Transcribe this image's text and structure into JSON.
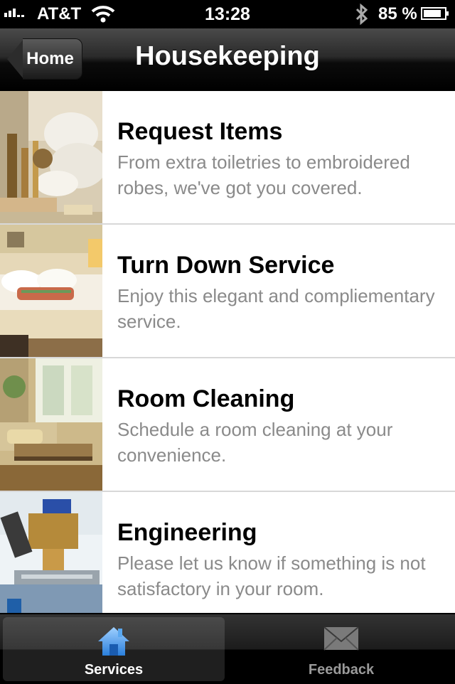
{
  "status_bar": {
    "carrier": "AT&T",
    "time": "13:28",
    "battery": "85 %",
    "battery_level": 0.85
  },
  "nav": {
    "back_label": "Home",
    "title": "Housekeeping"
  },
  "items": [
    {
      "title": "Request Items",
      "description": "From extra toiletries to embroidered robes, we've got you covered."
    },
    {
      "title": "Turn Down Service",
      "description": "Enjoy this elegant and compliementary service."
    },
    {
      "title": "Room Cleaning",
      "description": "Schedule a room cleaning at your convenience."
    },
    {
      "title": "Engineering",
      "description": "Please let us know if something is not satisfactory in your room."
    }
  ],
  "tabs": [
    {
      "label": "Services",
      "icon": "house-icon",
      "active": true
    },
    {
      "label": "Feedback",
      "icon": "envelope-icon",
      "active": false
    }
  ]
}
